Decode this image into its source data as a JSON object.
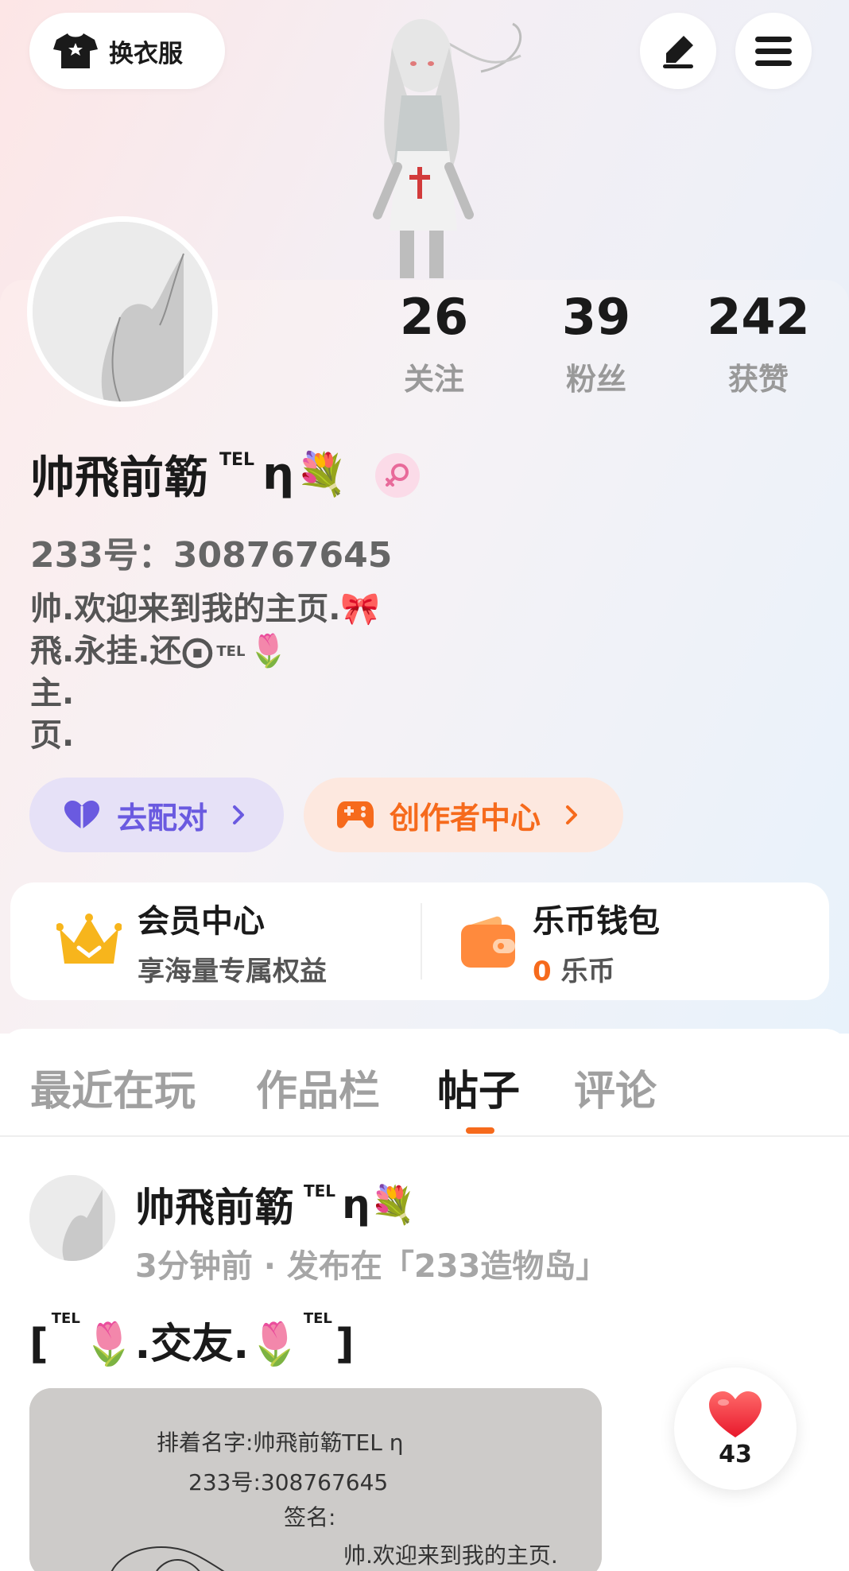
{
  "top_bar": {
    "outfit_label": "换衣服"
  },
  "stats": [
    {
      "value": "26",
      "label": "关注"
    },
    {
      "value": "39",
      "label": "粉丝"
    },
    {
      "value": "242",
      "label": "获赞"
    }
  ],
  "profile": {
    "name": "帅飛前簕",
    "name_tel": "TEL",
    "name_eta": "η",
    "name_flower": "💐",
    "uid": "233号：308767645",
    "bio_lines": [
      "帅.欢迎来到我的主页.🎀",
      "飛.永挂.还⨀",
      "主.",
      "页."
    ],
    "bio_line2_sup": "TEL",
    "bio_line2_tail": "🌷"
  },
  "actions": {
    "match_label": "去配对",
    "creator_label": "创作者中心"
  },
  "membership": {
    "title": "会员中心",
    "subtitle": "享海量专属权益"
  },
  "wallet": {
    "title": "乐币钱包",
    "amount": "0",
    "unit": "乐币"
  },
  "tabs": [
    {
      "label": "最近在玩",
      "active": false
    },
    {
      "label": "作品栏",
      "active": false
    },
    {
      "label": "帖子",
      "active": true
    },
    {
      "label": "评论",
      "active": false
    }
  ],
  "post": {
    "author_name": "帅飛前簕",
    "author_tel": "TEL",
    "author_eta": "η",
    "author_flower": "💐",
    "meta": "3分钟前 · 发布在「233造物岛」",
    "title_open": "[",
    "title_tel_left": "TEL",
    "title_body": "🌷.交友.🌷",
    "title_tel_right": "TEL",
    "title_close": "]",
    "image_text_lines": [
      "排着名字:帅飛前簕TEL η",
      "233号:308767645",
      "签名:",
      "帅.欢迎来到我的主页."
    ],
    "like_count": "43"
  },
  "colors": {
    "accent_orange": "#f66a1c",
    "match_purple": "#6a5ae0",
    "muted_gray": "#a0a0a0"
  }
}
